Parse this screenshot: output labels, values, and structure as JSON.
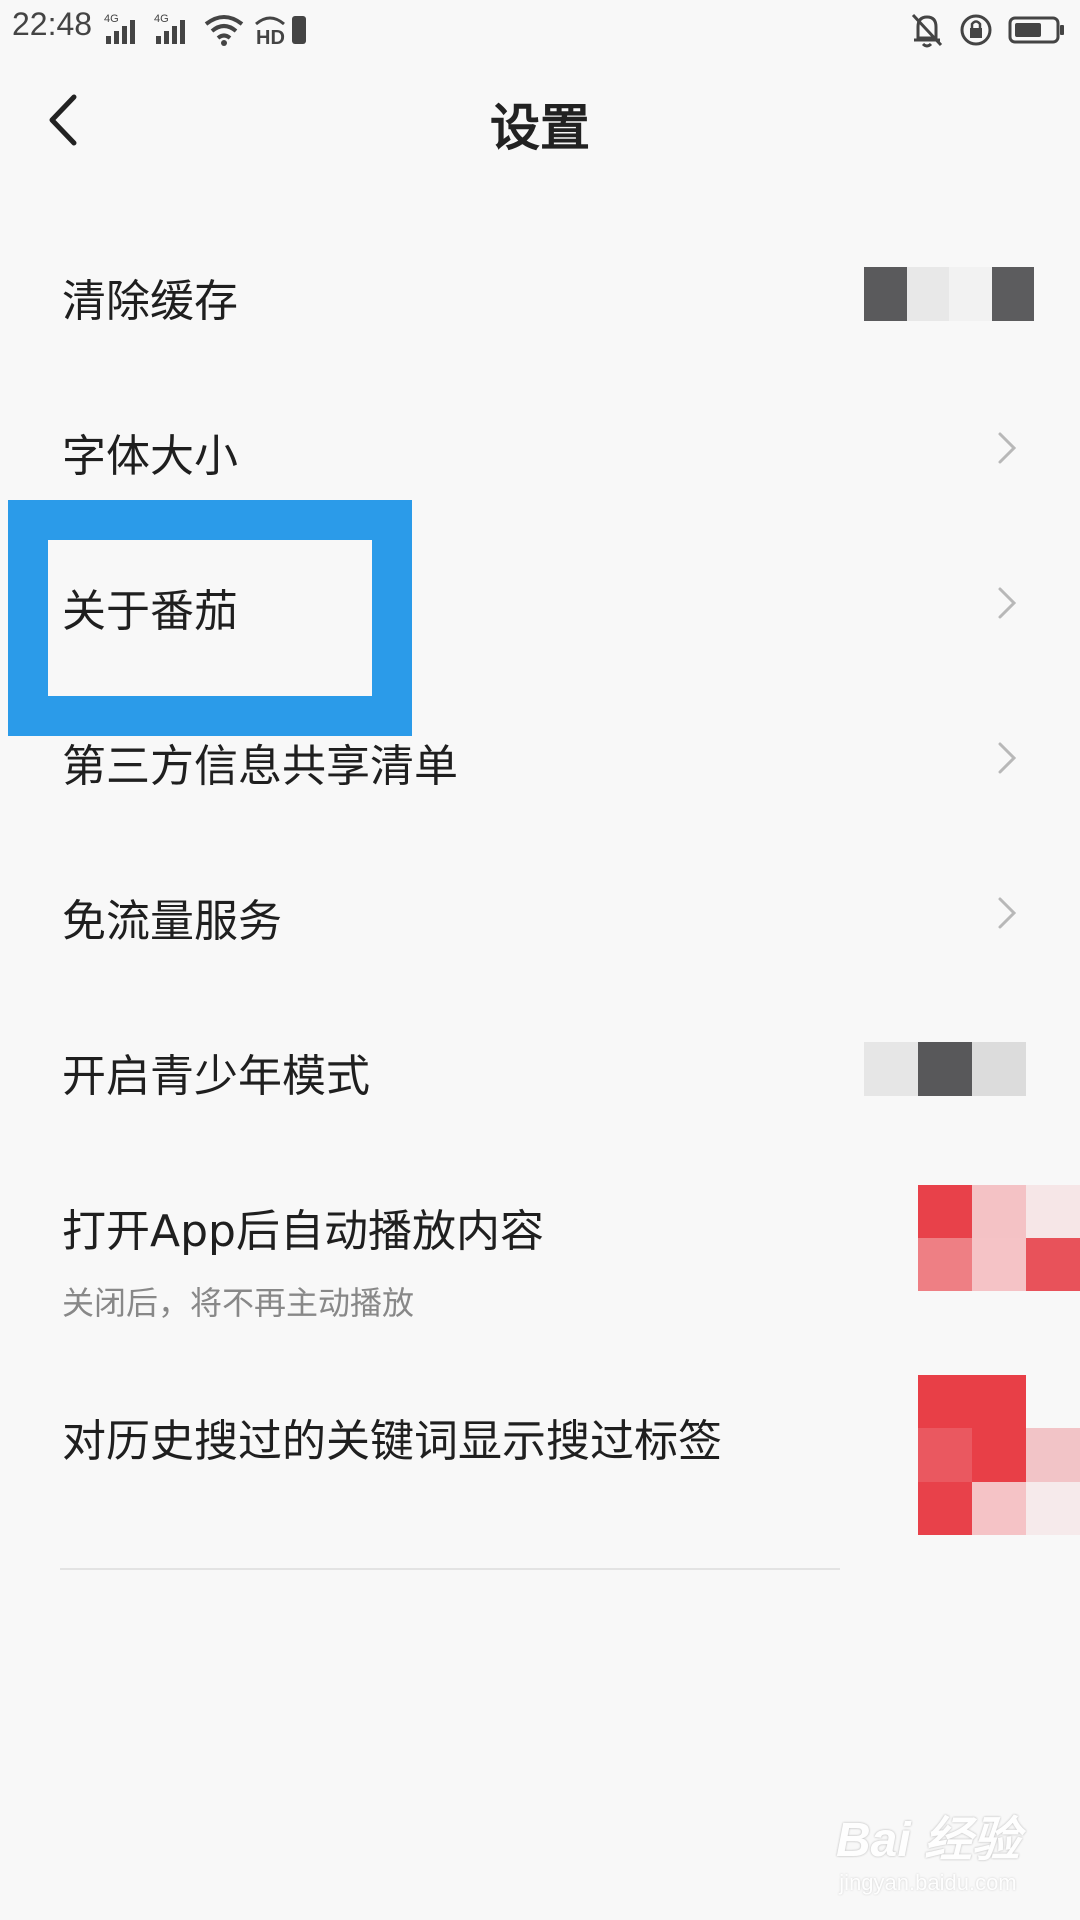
{
  "status_bar": {
    "time": "22:48",
    "net1": "4G",
    "net2": "4G",
    "hd_label": "HD"
  },
  "header": {
    "title": "设置"
  },
  "settings": [
    {
      "label": "清除缓存",
      "kind": "value"
    },
    {
      "label": "字体大小",
      "kind": "chevron"
    },
    {
      "label": "关于番茄",
      "kind": "chevron"
    },
    {
      "label": "第三方信息共享清单",
      "kind": "chevron"
    },
    {
      "label": "免流量服务",
      "kind": "chevron"
    },
    {
      "label": "开启青少年模式",
      "kind": "toggle-off"
    },
    {
      "label": "打开App后自动播放内容",
      "sublabel": "关闭后，将不再主动播放",
      "kind": "toggle-on"
    },
    {
      "label": "对历史搜过的关键词显示搜过标签",
      "kind": "toggle-on"
    }
  ],
  "watermark": {
    "logo": "Bai 经验",
    "url": "jingyan.baidu.com"
  },
  "colors": {
    "highlight": "#2b9be9",
    "accent": "#e8414a",
    "background": "#f8f8f8"
  }
}
